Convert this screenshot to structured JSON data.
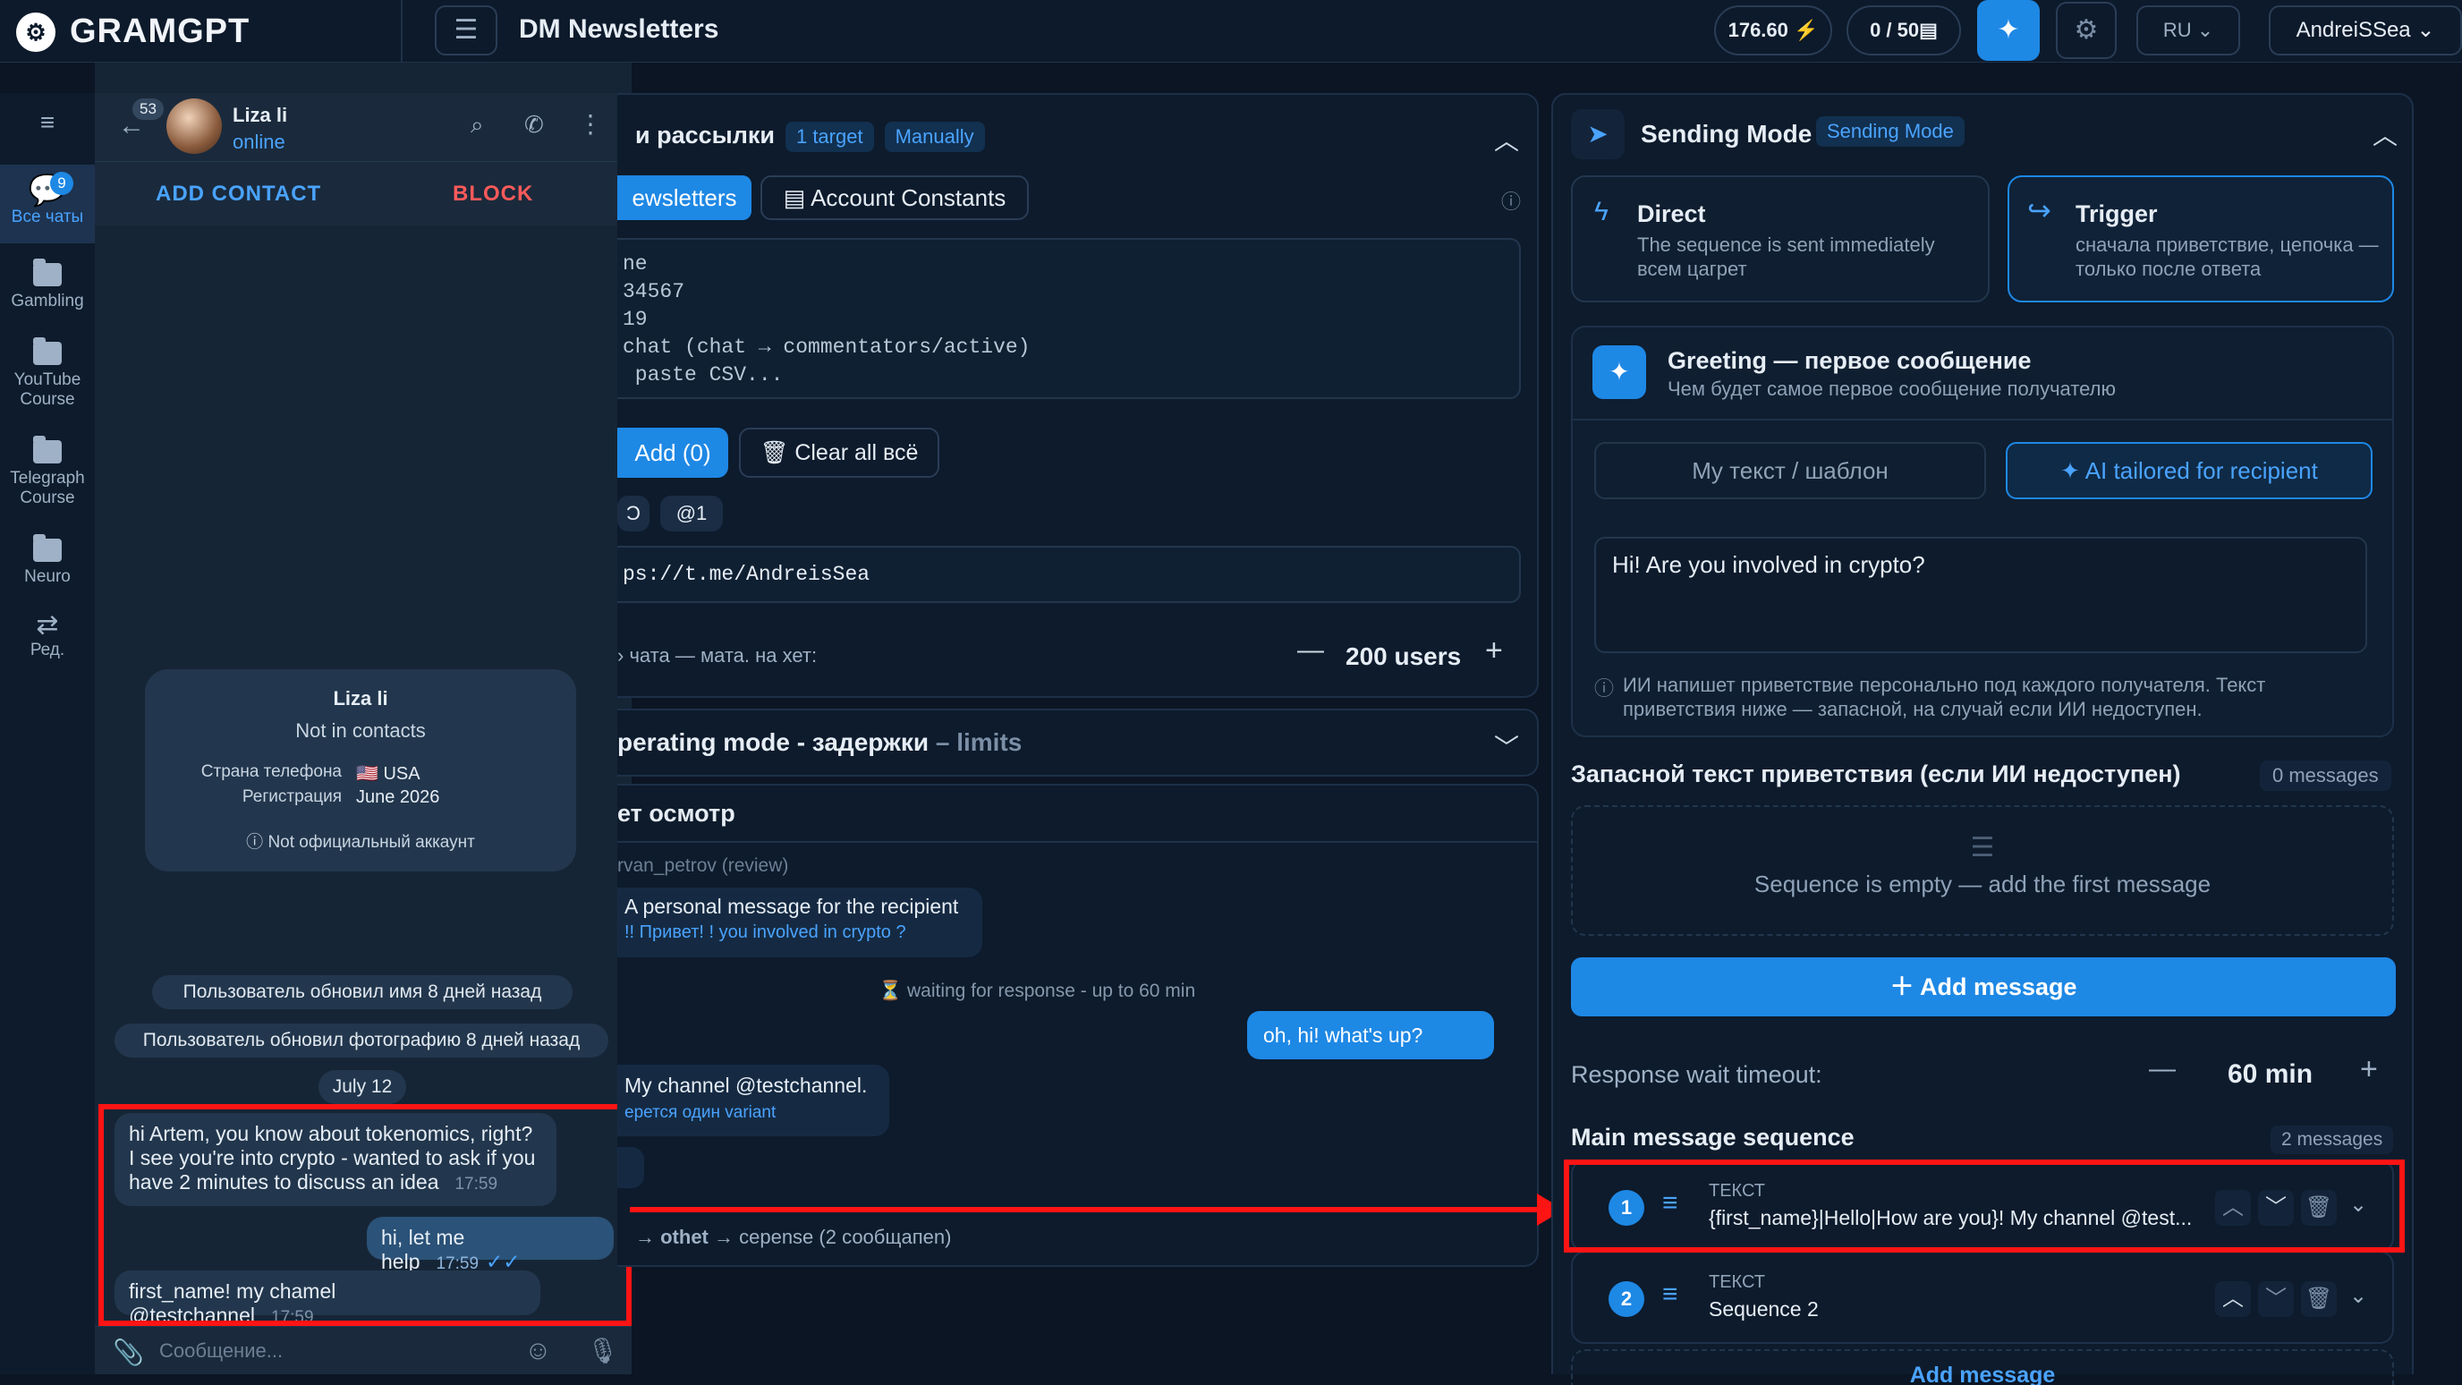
{
  "topbar": {
    "brand": "GRAMGPT",
    "title": "DM Newsletters",
    "balance": "176.60 ⚡",
    "quota": "0 / 50▤",
    "lang": "RU",
    "user": "AndreiSSea"
  },
  "sidebar": {
    "all_chats_badge": "9",
    "items": [
      {
        "label": "Все чаты"
      },
      {
        "label": "Gambling"
      },
      {
        "label": "YouTube Course"
      },
      {
        "label": "Telegraph Course"
      },
      {
        "label": "Neuro"
      },
      {
        "label": "Ред."
      }
    ]
  },
  "chat": {
    "unread": "53",
    "name": "Liza li",
    "status": "online",
    "add_contact": "ADD CONTACT",
    "block": "BLOCK",
    "card": {
      "name": "Liza li",
      "contact_state": "Not in contacts",
      "phone_label": "Страна телефона",
      "phone_value": "🇺🇸 USA",
      "reg_label": "Регистрация",
      "reg_value": "June 2026",
      "warning": "Not официальный аккаунт"
    },
    "system": [
      "Пользователь обновил имя 8 дней назад",
      "Пользователь обновил фотографию 8 дней назад",
      "July 12"
    ],
    "messages": [
      {
        "text": "hi Artem, you know about tokenomics, right? I see you're into crypto - wanted to ask if you have 2 minutes to discuss an idea",
        "time": "17:59"
      },
      {
        "text": "hi, let me help",
        "time": "17:59"
      },
      {
        "text": "first_name! my chamel @testchannel",
        "time": "17:59"
      }
    ],
    "input_placeholder": "Сообщение..."
  },
  "middle": {
    "header_title": "и рассылки",
    "header_tag1": "1 target",
    "header_tag2": "Manually",
    "tab_newsletters": "ewsletters",
    "tab_constants": "Account Constants",
    "textarea_lines": [
      "ne",
      "34567",
      "19",
      "chat (chat → commentators/active)",
      " paste CSV..."
    ],
    "add_btn": "Add (0)",
    "clear_btn": "Clear all всё",
    "chip1": "Ɔ",
    "chip2": "@1",
    "url": "ps://t.me/AndreisSea",
    "limit_label": "› чата — мата. на хет:",
    "limit_value": "200 users",
    "section2_bold": "perating mode - задержки",
    "section2_rest": " – limits",
    "preview_title": "ет осмотр",
    "preview_user": "rvan_petrov (review)",
    "preview_msg1": "A personal message for the recipient",
    "preview_msg1_sub": "!! Привет! ! you involved in crypto ?",
    "preview_wait": "⏳ waiting for response - up to 60 min",
    "preview_reply": "oh, hi! what's up?",
    "preview_msg2": "My channel @testchannel.",
    "preview_msg2_sub": "ерется один variant",
    "preview_footer_bold": "→ othet",
    "preview_footer": " → cepense (2 сообщапеn)"
  },
  "right": {
    "sending_title": "Sending Mode",
    "sending_tag": "Sending Mode",
    "direct_title": "Direct",
    "direct_desc": "The sequence is sent immediately всем цагрет",
    "trigger_title": "Trigger",
    "trigger_desc": "сначала приветствие, цепочка — только после ответа",
    "greeting_title": "Greeting — первое сообщение",
    "greeting_sub": "Чем будет самое первое сообщение получателю",
    "opt_template": "My текст / шаблон",
    "opt_ai": "AI tailored for recipient",
    "greeting_text": "Hi! Are you involved in crypto?",
    "ai_note": "ИИ напишет приветствие персонально под каждого получателя. Текст приветствия ниже — запасной, на случай если ИИ недоступен.",
    "fallback_title": "Запасной текст приветствия (если ИИ недоступен)",
    "fallback_count": "0 messages",
    "empty_text": "Sequence is empty — add the first message",
    "add_message": "Add message",
    "timeout_label": "Response wait timeout:",
    "timeout_value": "60 min",
    "main_seq_title": "Main message sequence",
    "main_seq_count": "2 messages",
    "seq": [
      {
        "n": "1",
        "type": "ТЕКСТ",
        "text": "{first_name}|Hello|How are you}! My channel @test..."
      },
      {
        "n": "2",
        "type": "ТЕКСТ",
        "text": "Sequence 2"
      }
    ],
    "add_message_bottom": "Add message"
  },
  "colors": {
    "accent": "#1e88e5",
    "highlight": "#ff1414",
    "background": "#0b1524"
  }
}
